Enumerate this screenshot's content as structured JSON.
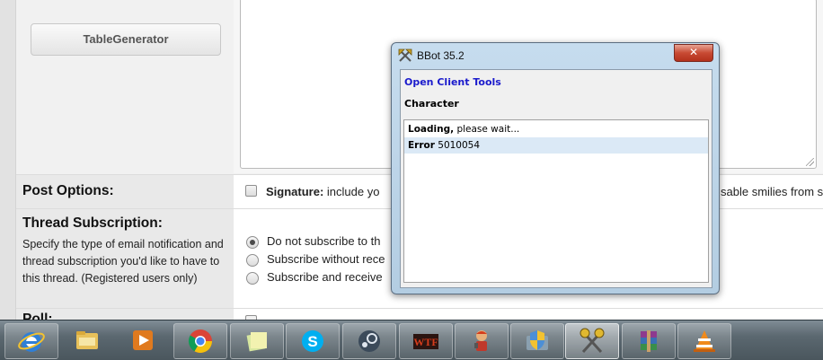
{
  "page": {
    "tablegenerator_button": "TableGenerator",
    "post_options": {
      "title": "Post Options:",
      "signature_label": "Signature:",
      "signature_text": "include yo",
      "smilies_text": "sable smilies from s"
    },
    "thread_subscription": {
      "title": "Thread Subscription:",
      "description": "Specify the type of email notification and thread subscription you'd like to have to this thread. (Registered users only)",
      "options": [
        "Do not subscribe to th",
        "Subscribe without rece",
        "Subscribe and receive"
      ],
      "selected_index": 0
    },
    "poll_title": "Poll:"
  },
  "dialog": {
    "title": "BBot 35.2",
    "close_glyph": "✕",
    "link": "Open Client Tools",
    "section": "Character",
    "log": [
      {
        "key": "Loading,",
        "value": "please wait..."
      },
      {
        "key": "Error",
        "value": "5010054"
      }
    ]
  },
  "taskbar": {
    "items": [
      {
        "name": "internet-explorer-icon",
        "state": "running"
      },
      {
        "name": "file-explorer-icon",
        "state": "idle"
      },
      {
        "name": "media-player-icon",
        "state": "idle"
      },
      {
        "name": "chrome-icon",
        "state": "running"
      },
      {
        "name": "sticky-notes-icon",
        "state": "running"
      },
      {
        "name": "skype-icon",
        "state": "running"
      },
      {
        "name": "steam-icon",
        "state": "running"
      },
      {
        "name": "wtf-app-icon",
        "state": "running"
      },
      {
        "name": "game-character-icon",
        "state": "running"
      },
      {
        "name": "security-shield-icon",
        "state": "running"
      },
      {
        "name": "bbot-icon",
        "state": "active"
      },
      {
        "name": "winrar-icon",
        "state": "running"
      },
      {
        "name": "vlc-icon",
        "state": "running"
      }
    ],
    "wtf_label": "WTF"
  },
  "colors": {
    "link": "#1a1acc",
    "dialog_frame": "#b3cde2",
    "selected_row": "#dbe9f6",
    "close_button": "#c84a33"
  }
}
